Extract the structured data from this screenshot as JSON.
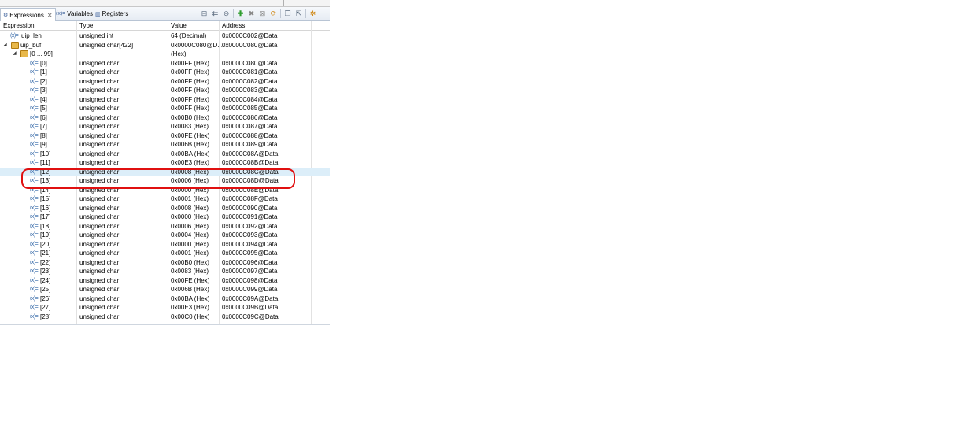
{
  "tabs": [
    {
      "label": "Expressions",
      "icon": "expressions-icon",
      "active": true
    },
    {
      "label": "Variables",
      "icon": "variables-icon",
      "active": false
    },
    {
      "label": "Registers",
      "icon": "registers-icon",
      "active": false
    }
  ],
  "toolbar": [
    "collapse-all-icon",
    "select-all-icon",
    "collapse-icon",
    "add-expression-icon",
    "remove-icon",
    "remove-all-icon",
    "refresh-icon",
    "new-view-icon",
    "export-icon",
    "settings-icon"
  ],
  "columns": {
    "expression": "Expression",
    "type": "Type",
    "value": "Value",
    "address": "Address"
  },
  "rows": [
    {
      "expression": "uip_len",
      "type": "unsigned int",
      "value": "64 (Decimal)",
      "address": "0x0000C002@Data",
      "kind": "var",
      "depth": 0
    },
    {
      "expression": "uip_buf",
      "type": "unsigned char[422]",
      "value": "0x0000C080@D...",
      "address": "0x0000C080@Data",
      "kind": "array",
      "depth": 0,
      "expanded": true
    },
    {
      "expression": "[0 ... 99]",
      "type": "",
      "value": "(Hex)",
      "address": "",
      "kind": "array",
      "depth": 1,
      "expanded": true
    },
    {
      "expression": "[0]",
      "type": "unsigned char",
      "value": "0x00FF (Hex)",
      "address": "0x0000C080@Data",
      "kind": "var",
      "depth": 2
    },
    {
      "expression": "[1]",
      "type": "unsigned char",
      "value": "0x00FF (Hex)",
      "address": "0x0000C081@Data",
      "kind": "var",
      "depth": 2
    },
    {
      "expression": "[2]",
      "type": "unsigned char",
      "value": "0x00FF (Hex)",
      "address": "0x0000C082@Data",
      "kind": "var",
      "depth": 2
    },
    {
      "expression": "[3]",
      "type": "unsigned char",
      "value": "0x00FF (Hex)",
      "address": "0x0000C083@Data",
      "kind": "var",
      "depth": 2
    },
    {
      "expression": "[4]",
      "type": "unsigned char",
      "value": "0x00FF (Hex)",
      "address": "0x0000C084@Data",
      "kind": "var",
      "depth": 2
    },
    {
      "expression": "[5]",
      "type": "unsigned char",
      "value": "0x00FF (Hex)",
      "address": "0x0000C085@Data",
      "kind": "var",
      "depth": 2
    },
    {
      "expression": "[6]",
      "type": "unsigned char",
      "value": "0x00B0 (Hex)",
      "address": "0x0000C086@Data",
      "kind": "var",
      "depth": 2
    },
    {
      "expression": "[7]",
      "type": "unsigned char",
      "value": "0x0083 (Hex)",
      "address": "0x0000C087@Data",
      "kind": "var",
      "depth": 2
    },
    {
      "expression": "[8]",
      "type": "unsigned char",
      "value": "0x00FE (Hex)",
      "address": "0x0000C088@Data",
      "kind": "var",
      "depth": 2
    },
    {
      "expression": "[9]",
      "type": "unsigned char",
      "value": "0x006B (Hex)",
      "address": "0x0000C089@Data",
      "kind": "var",
      "depth": 2
    },
    {
      "expression": "[10]",
      "type": "unsigned char",
      "value": "0x00BA (Hex)",
      "address": "0x0000C08A@Data",
      "kind": "var",
      "depth": 2
    },
    {
      "expression": "[11]",
      "type": "unsigned char",
      "value": "0x00E3 (Hex)",
      "address": "0x0000C08B@Data",
      "kind": "var",
      "depth": 2
    },
    {
      "expression": "[12]",
      "type": "unsigned char",
      "value": "0x0008 (Hex)",
      "address": "0x0000C08C@Data",
      "kind": "var",
      "depth": 2,
      "selected": true
    },
    {
      "expression": "[13]",
      "type": "unsigned char",
      "value": "0x0006 (Hex)",
      "address": "0x0000C08D@Data",
      "kind": "var",
      "depth": 2
    },
    {
      "expression": "[14]",
      "type": "unsigned char",
      "value": "0x0000 (Hex)",
      "address": "0x0000C08E@Data",
      "kind": "var",
      "depth": 2
    },
    {
      "expression": "[15]",
      "type": "unsigned char",
      "value": "0x0001 (Hex)",
      "address": "0x0000C08F@Data",
      "kind": "var",
      "depth": 2
    },
    {
      "expression": "[16]",
      "type": "unsigned char",
      "value": "0x0008 (Hex)",
      "address": "0x0000C090@Data",
      "kind": "var",
      "depth": 2
    },
    {
      "expression": "[17]",
      "type": "unsigned char",
      "value": "0x0000 (Hex)",
      "address": "0x0000C091@Data",
      "kind": "var",
      "depth": 2
    },
    {
      "expression": "[18]",
      "type": "unsigned char",
      "value": "0x0006 (Hex)",
      "address": "0x0000C092@Data",
      "kind": "var",
      "depth": 2
    },
    {
      "expression": "[19]",
      "type": "unsigned char",
      "value": "0x0004 (Hex)",
      "address": "0x0000C093@Data",
      "kind": "var",
      "depth": 2
    },
    {
      "expression": "[20]",
      "type": "unsigned char",
      "value": "0x0000 (Hex)",
      "address": "0x0000C094@Data",
      "kind": "var",
      "depth": 2
    },
    {
      "expression": "[21]",
      "type": "unsigned char",
      "value": "0x0001 (Hex)",
      "address": "0x0000C095@Data",
      "kind": "var",
      "depth": 2
    },
    {
      "expression": "[22]",
      "type": "unsigned char",
      "value": "0x00B0 (Hex)",
      "address": "0x0000C096@Data",
      "kind": "var",
      "depth": 2
    },
    {
      "expression": "[23]",
      "type": "unsigned char",
      "value": "0x0083 (Hex)",
      "address": "0x0000C097@Data",
      "kind": "var",
      "depth": 2
    },
    {
      "expression": "[24]",
      "type": "unsigned char",
      "value": "0x00FE (Hex)",
      "address": "0x0000C098@Data",
      "kind": "var",
      "depth": 2
    },
    {
      "expression": "[25]",
      "type": "unsigned char",
      "value": "0x006B (Hex)",
      "address": "0x0000C099@Data",
      "kind": "var",
      "depth": 2
    },
    {
      "expression": "[26]",
      "type": "unsigned char",
      "value": "0x00BA (Hex)",
      "address": "0x0000C09A@Data",
      "kind": "var",
      "depth": 2
    },
    {
      "expression": "[27]",
      "type": "unsigned char",
      "value": "0x00E3 (Hex)",
      "address": "0x0000C09B@Data",
      "kind": "var",
      "depth": 2
    },
    {
      "expression": "[28]",
      "type": "unsigned char",
      "value": "0x00C0 (Hex)",
      "address": "0x0000C09C@Data",
      "kind": "var",
      "depth": 2
    }
  ],
  "annotation": {
    "color": "#e01010",
    "label": "highlighted-rows-12-13"
  },
  "colors": {
    "selection": "#dceef9",
    "accent": "#3468a8"
  }
}
